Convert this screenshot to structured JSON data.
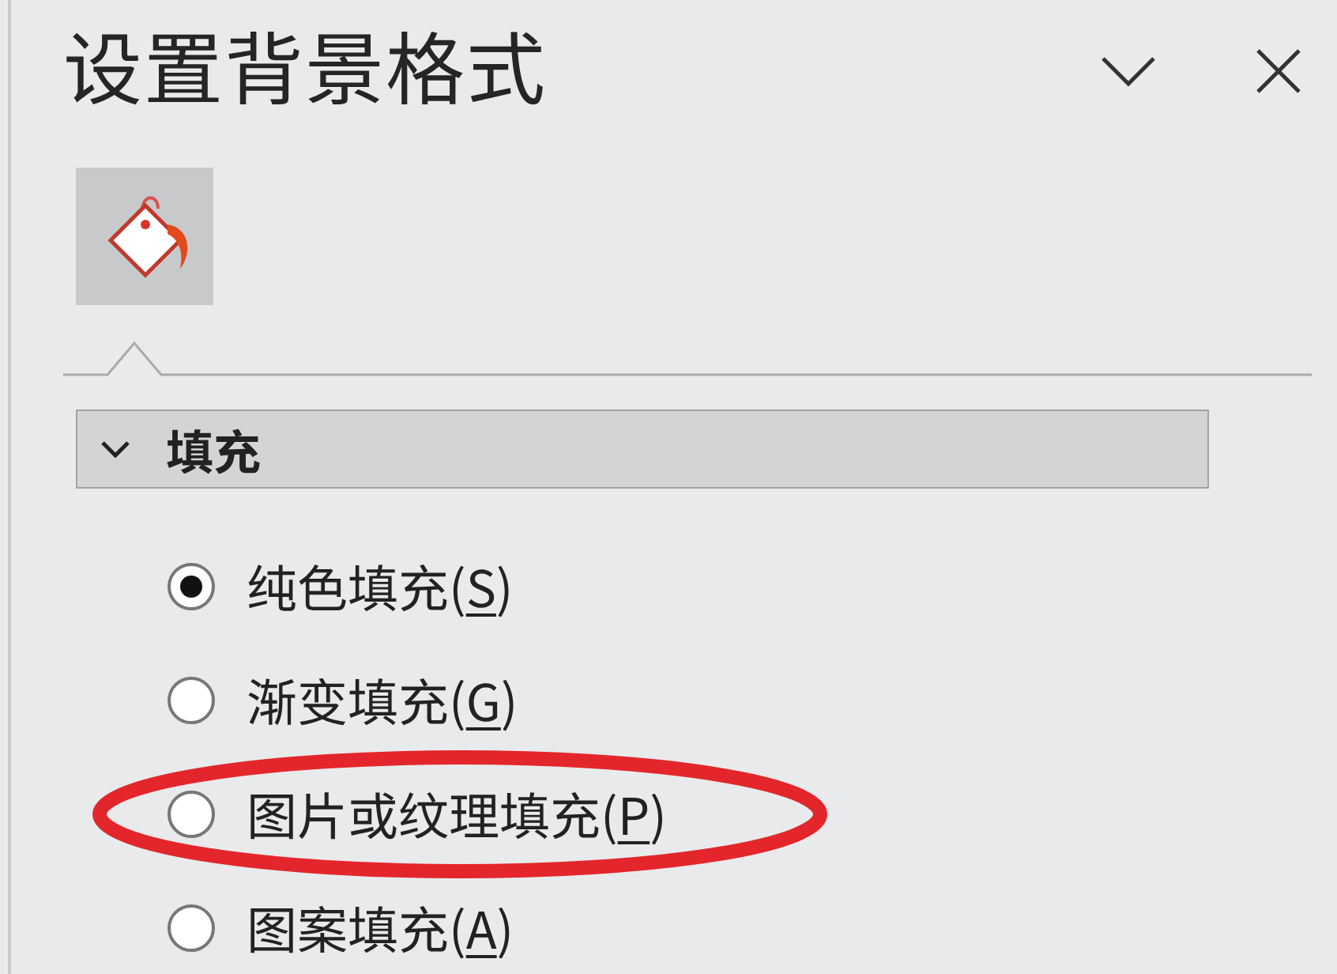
{
  "panel": {
    "title": "设置背景格式"
  },
  "tabs": [
    {
      "kind": "fill",
      "selected": true
    }
  ],
  "section": {
    "title": "填充",
    "expanded": true
  },
  "options": [
    {
      "text_before": "纯色填充(",
      "access_key": "S",
      "text_after": ")",
      "selected": true,
      "circled": false
    },
    {
      "text_before": "渐变填充(",
      "access_key": "G",
      "text_after": ")",
      "selected": false,
      "circled": false
    },
    {
      "text_before": "图片或纹理填充(",
      "access_key": "P",
      "text_after": ")",
      "selected": false,
      "circled": true
    },
    {
      "text_before": "图案填充(",
      "access_key": "A",
      "text_after": ")",
      "selected": false,
      "circled": false
    }
  ]
}
